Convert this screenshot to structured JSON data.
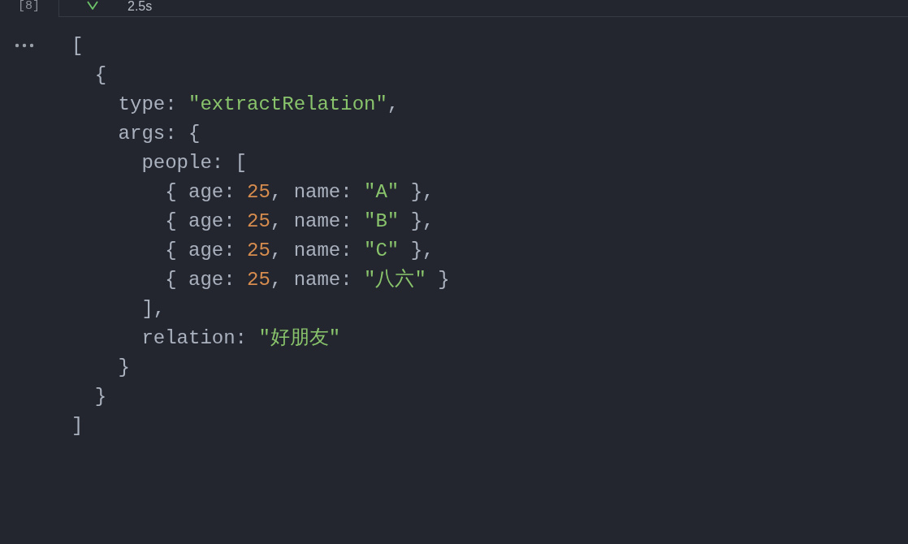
{
  "cell": {
    "execution_count": "[8]",
    "succeeded": true,
    "duration": "2.5s"
  },
  "output": {
    "lines": [
      {
        "tokens": [
          {
            "text": "[",
            "kind": "plain"
          }
        ],
        "children": [
          {
            "tokens": [
              {
                "text": "{",
                "kind": "plain"
              }
            ],
            "children": [
              {
                "tokens": [
                  {
                    "text": "type: ",
                    "kind": "plain"
                  },
                  {
                    "text": "\"extractRelation\"",
                    "kind": "string"
                  },
                  {
                    "text": ",",
                    "kind": "plain"
                  }
                ]
              },
              {
                "tokens": [
                  {
                    "text": "args: {",
                    "kind": "plain"
                  }
                ],
                "children": [
                  {
                    "tokens": [
                      {
                        "text": "people: [",
                        "kind": "plain"
                      }
                    ],
                    "children": [
                      {
                        "tokens": [
                          {
                            "text": "{ age: ",
                            "kind": "plain"
                          },
                          {
                            "text": "25",
                            "kind": "number"
                          },
                          {
                            "text": ", name: ",
                            "kind": "plain"
                          },
                          {
                            "text": "\"A\"",
                            "kind": "string"
                          },
                          {
                            "text": " },",
                            "kind": "plain"
                          }
                        ]
                      },
                      {
                        "tokens": [
                          {
                            "text": "{ age: ",
                            "kind": "plain"
                          },
                          {
                            "text": "25",
                            "kind": "number"
                          },
                          {
                            "text": ", name: ",
                            "kind": "plain"
                          },
                          {
                            "text": "\"B\"",
                            "kind": "string"
                          },
                          {
                            "text": " },",
                            "kind": "plain"
                          }
                        ]
                      },
                      {
                        "tokens": [
                          {
                            "text": "{ age: ",
                            "kind": "plain"
                          },
                          {
                            "text": "25",
                            "kind": "number"
                          },
                          {
                            "text": ", name: ",
                            "kind": "plain"
                          },
                          {
                            "text": "\"C\"",
                            "kind": "string"
                          },
                          {
                            "text": " },",
                            "kind": "plain"
                          }
                        ]
                      },
                      {
                        "tokens": [
                          {
                            "text": "{ age: ",
                            "kind": "plain"
                          },
                          {
                            "text": "25",
                            "kind": "number"
                          },
                          {
                            "text": ", name: ",
                            "kind": "plain"
                          },
                          {
                            "text": "\"八六\"",
                            "kind": "string"
                          },
                          {
                            "text": " }",
                            "kind": "plain"
                          }
                        ]
                      }
                    ]
                  },
                  {
                    "tokens": [
                      {
                        "text": "],",
                        "kind": "plain"
                      }
                    ]
                  },
                  {
                    "tokens": [
                      {
                        "text": "relation: ",
                        "kind": "plain"
                      },
                      {
                        "text": "\"好朋友\"",
                        "kind": "string"
                      }
                    ]
                  }
                ]
              },
              {
                "tokens": [
                  {
                    "text": "}",
                    "kind": "plain"
                  }
                ]
              }
            ]
          },
          {
            "tokens": [
              {
                "text": "}",
                "kind": "plain"
              }
            ]
          }
        ]
      },
      {
        "tokens": [
          {
            "text": "]",
            "kind": "plain"
          }
        ]
      }
    ]
  }
}
